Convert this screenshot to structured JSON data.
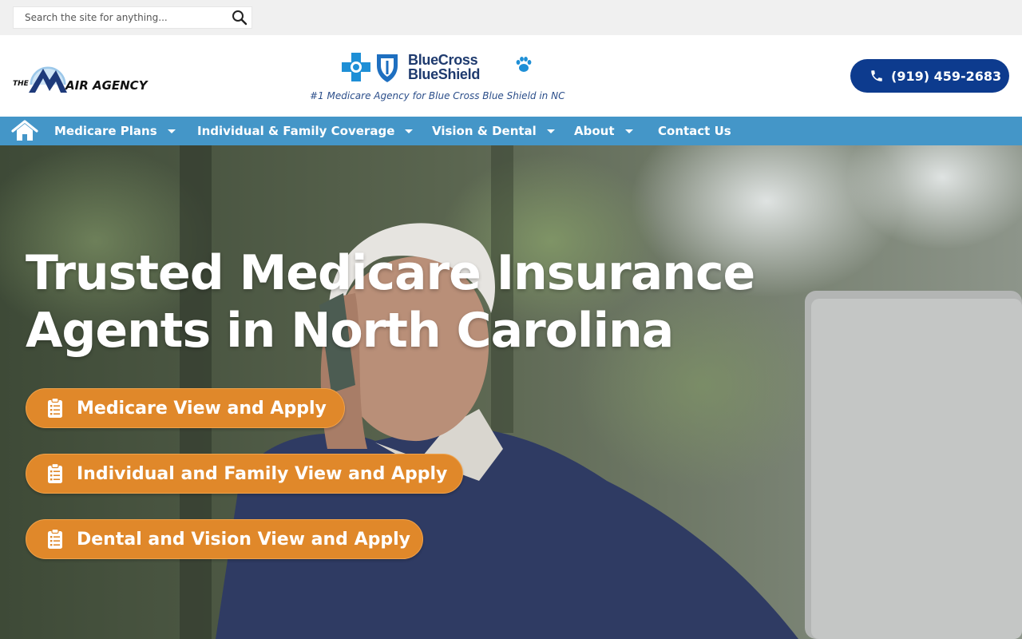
{
  "search": {
    "placeholder": "Search the site for anything..."
  },
  "header": {
    "logo_text": "THE MAIR AGENCY",
    "partner_logo_line1": "BlueCross",
    "partner_logo_line2": "BlueShield",
    "tagline": "#1 Medicare Agency for Blue Cross Blue Shield in NC",
    "phone": "(919) 459-2683"
  },
  "nav": {
    "items": [
      {
        "label": "Medicare Plans",
        "has_dropdown": true
      },
      {
        "label": "Individual & Family Coverage",
        "has_dropdown": true
      },
      {
        "label": "Vision & Dental",
        "has_dropdown": true
      },
      {
        "label": "About",
        "has_dropdown": true
      },
      {
        "label": "Contact Us",
        "has_dropdown": false
      }
    ]
  },
  "hero": {
    "title_line1": "Trusted Medicare Insurance",
    "title_line2": "Agents in North Carolina",
    "buttons": [
      {
        "label": "Medicare View and Apply",
        "icon": "clipboard-icon"
      },
      {
        "label": "Individual and Family View and Apply",
        "icon": "clipboard-icon"
      },
      {
        "label": "Dental and Vision View and Apply",
        "icon": "clipboard-icon"
      }
    ]
  },
  "colors": {
    "primary_blue": "#0d3b8e",
    "nav_blue": "#4496c8",
    "cta_orange": "#e0882a",
    "topbar_gray": "#f0f0f0"
  }
}
